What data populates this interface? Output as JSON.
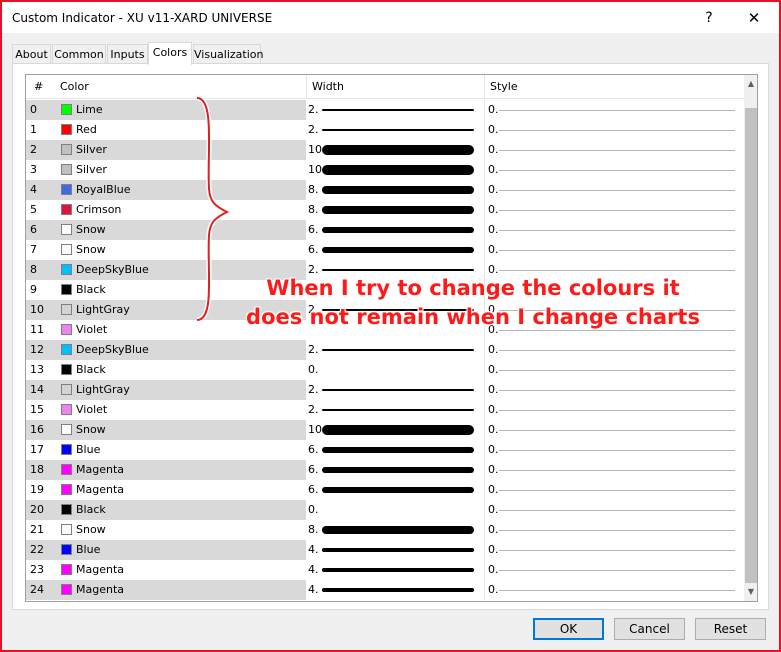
{
  "window": {
    "title": "Custom Indicator - XU v11-XARD UNIVERSE",
    "help": "?",
    "close": "✕"
  },
  "tabs": [
    "About",
    "Common",
    "Inputs",
    "Colors",
    "Visualization"
  ],
  "active_tab": "Colors",
  "columns": {
    "num": "#",
    "color": "Color",
    "width": "Width",
    "style": "Style"
  },
  "rows": [
    {
      "num": "0",
      "color": "Lime",
      "hex": "#00ff00",
      "width": "2.",
      "style": "0."
    },
    {
      "num": "1",
      "color": "Red",
      "hex": "#ff0000",
      "width": "2.",
      "style": "0."
    },
    {
      "num": "2",
      "color": "Silver",
      "hex": "#c0c0c0",
      "width": "10.",
      "style": "0."
    },
    {
      "num": "3",
      "color": "Silver",
      "hex": "#c0c0c0",
      "width": "10.",
      "style": "0."
    },
    {
      "num": "4",
      "color": "RoyalBlue",
      "hex": "#4169e1",
      "width": "8.",
      "style": "0."
    },
    {
      "num": "5",
      "color": "Crimson",
      "hex": "#dc143c",
      "width": "8.",
      "style": "0."
    },
    {
      "num": "6",
      "color": "Snow",
      "hex": "#fffafa",
      "width": "6.",
      "style": "0."
    },
    {
      "num": "7",
      "color": "Snow",
      "hex": "#fffafa",
      "width": "6.",
      "style": "0."
    },
    {
      "num": "8",
      "color": "DeepSkyBlue",
      "hex": "#00bfff",
      "width": "2.",
      "style": "0."
    },
    {
      "num": "9",
      "color": "Black",
      "hex": "#000000",
      "width": "",
      "style": ""
    },
    {
      "num": "10",
      "color": "LightGray",
      "hex": "#d3d3d3",
      "width": "2.",
      "style": "0."
    },
    {
      "num": "11",
      "color": "Violet",
      "hex": "#ee82ee",
      "width": "",
      "style": "0."
    },
    {
      "num": "12",
      "color": "DeepSkyBlue",
      "hex": "#00bfff",
      "width": "2.",
      "style": "0."
    },
    {
      "num": "13",
      "color": "Black",
      "hex": "#000000",
      "width": "0.",
      "style": "0."
    },
    {
      "num": "14",
      "color": "LightGray",
      "hex": "#d3d3d3",
      "width": "2.",
      "style": "0."
    },
    {
      "num": "15",
      "color": "Violet",
      "hex": "#ee82ee",
      "width": "2.",
      "style": "0."
    },
    {
      "num": "16",
      "color": "Snow",
      "hex": "#fffafa",
      "width": "10.",
      "style": "0."
    },
    {
      "num": "17",
      "color": "Blue",
      "hex": "#0000ff",
      "width": "6.",
      "style": "0."
    },
    {
      "num": "18",
      "color": "Magenta",
      "hex": "#ff00ff",
      "width": "6.",
      "style": "0."
    },
    {
      "num": "19",
      "color": "Magenta",
      "hex": "#ff00ff",
      "width": "6.",
      "style": "0."
    },
    {
      "num": "20",
      "color": "Black",
      "hex": "#000000",
      "width": "0.",
      "style": "0."
    },
    {
      "num": "21",
      "color": "Snow",
      "hex": "#fffafa",
      "width": "8.",
      "style": "0."
    },
    {
      "num": "22",
      "color": "Blue",
      "hex": "#0000ff",
      "width": "4.",
      "style": "0."
    },
    {
      "num": "23",
      "color": "Magenta",
      "hex": "#ff00ff",
      "width": "4.",
      "style": "0."
    },
    {
      "num": "24",
      "color": "Magenta",
      "hex": "#ff00ff",
      "width": "4.",
      "style": "0."
    }
  ],
  "annotation": {
    "line1": "When I try to change the colours it",
    "line2": "does not remain when I change charts",
    "color": "#ff1a1a"
  },
  "buttons": {
    "ok": "OK",
    "cancel": "Cancel",
    "reset": "Reset"
  }
}
